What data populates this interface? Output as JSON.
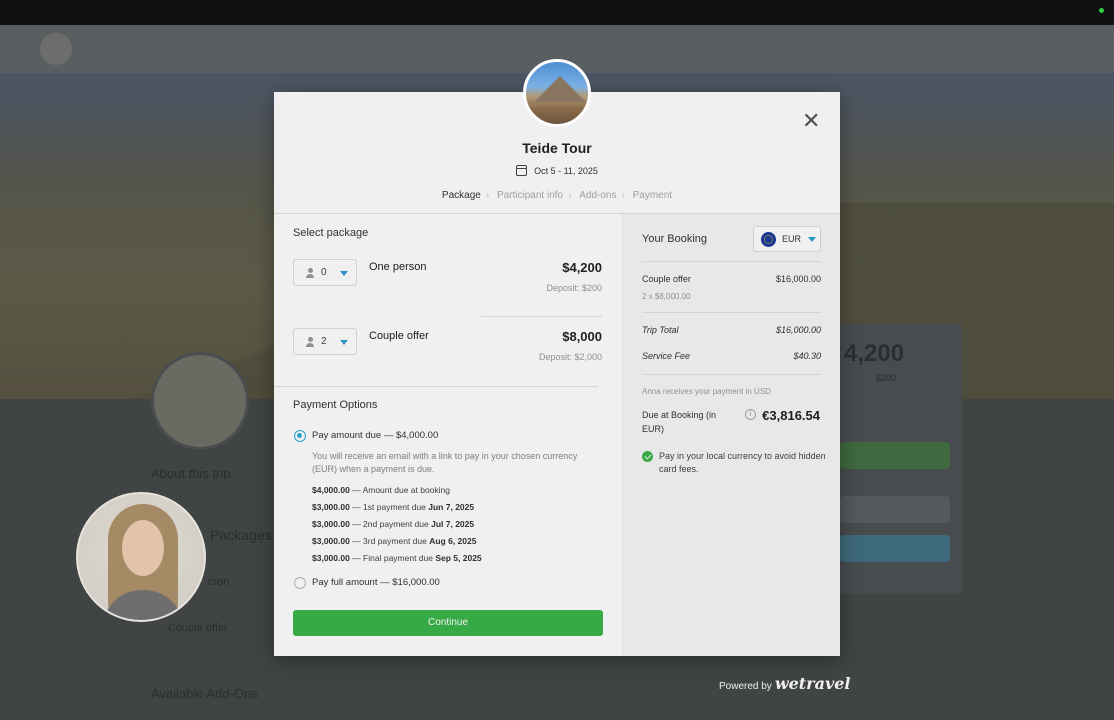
{
  "modal": {
    "title": "Teide Tour",
    "dates": "Oct 5 - 11, 2025",
    "steps": [
      "Package",
      "Participant info",
      "Add-ons",
      "Payment"
    ],
    "close_icon": "close-icon"
  },
  "packages": {
    "heading": "Select package",
    "items": [
      {
        "qty": "0",
        "name": "One person",
        "price": "$4,200",
        "deposit": "Deposit: $200"
      },
      {
        "qty": "2",
        "name": "Couple offer",
        "price": "$8,000",
        "deposit": "Deposit: $2,000"
      }
    ]
  },
  "payment": {
    "heading": "Payment Options",
    "option_due": "Pay amount due — $4,000.00",
    "note": "You will receive an email with a link to pay in your chosen currency (EUR) when a payment is due.",
    "schedule": [
      {
        "amount": "$4,000.00",
        "text": " — Amount due at booking",
        "date": ""
      },
      {
        "amount": "$3,000.00",
        "text": " — 1st payment due ",
        "date": "Jun 7, 2025"
      },
      {
        "amount": "$3,000.00",
        "text": " — 2nd payment due ",
        "date": "Jul 7, 2025"
      },
      {
        "amount": "$3,000.00",
        "text": " — 3rd payment due ",
        "date": "Aug 6, 2025"
      },
      {
        "amount": "$3,000.00",
        "text": " — Final payment due ",
        "date": "Sep 5, 2025"
      }
    ],
    "option_full": "Pay full amount — $16,000.00",
    "continue_label": "Continue"
  },
  "booking": {
    "title": "Your Booking",
    "currency": "EUR",
    "line_label": "Couple offer",
    "line_value": "$16,000.00",
    "line_sub": "2 x $8,000.00",
    "trip_total_label": "Trip Total",
    "trip_total_value": "$16,000.00",
    "service_fee_label": "Service Fee",
    "service_fee_value": "$40.30",
    "receives_note": "Anna receives your payment in USD",
    "due_label": "Due at Booking (in EUR)",
    "due_value": "€3,816.54",
    "tip": "Pay in your local currency to avoid hidden card fees."
  },
  "footer": {
    "powered_by": "Powered by",
    "brand": "wetravel"
  },
  "background": {
    "about": "About this trip",
    "packages": "Packages",
    "person": "rson",
    "couple": "Couple offer",
    "addons": "Available Add-Ons",
    "price": "4,200",
    "price_sub": "$200"
  },
  "colors": {
    "accent": "#2eaad8",
    "primary_button": "#3bb54a"
  }
}
